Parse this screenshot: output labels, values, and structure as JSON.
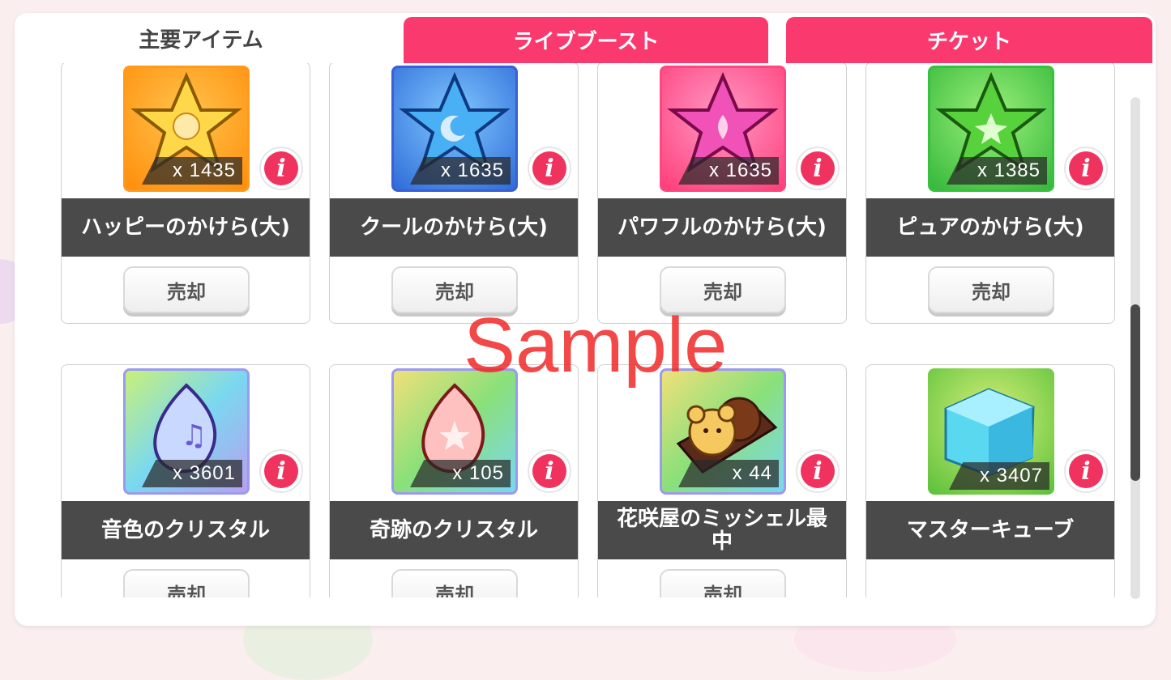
{
  "tabs": [
    {
      "label": "主要アイテム",
      "active": true
    },
    {
      "label": "ライブブースト",
      "active": false
    },
    {
      "label": "チケット",
      "active": false
    }
  ],
  "items": [
    {
      "name": "ハッピーのかけら(大)",
      "qty": "x 1435",
      "icon": "happy-star-icon",
      "sell": "売却"
    },
    {
      "name": "クールのかけら(大)",
      "qty": "x 1635",
      "icon": "cool-star-icon",
      "sell": "売却"
    },
    {
      "name": "パワフルのかけら(大)",
      "qty": "x 1635",
      "icon": "powerful-star-icon",
      "sell": "売却"
    },
    {
      "name": "ピュアのかけら(大)",
      "qty": "x 1385",
      "icon": "pure-star-icon",
      "sell": "売却"
    },
    {
      "name": "音色のクリスタル",
      "qty": "x 3601",
      "icon": "tone-crystal-icon",
      "sell": "売却"
    },
    {
      "name": "奇跡のクリスタル",
      "qty": "x 105",
      "icon": "miracle-crystal-icon",
      "sell": "売却"
    },
    {
      "name": "花咲屋のミッシェル最中",
      "qty": "x 44",
      "icon": "michelle-monaka-icon",
      "sell": "売却"
    },
    {
      "name": "マスターキューブ",
      "qty": "x 3407",
      "icon": "master-cube-icon",
      "sell": ""
    }
  ],
  "info_label": "i",
  "watermark": "Sample",
  "colors": {
    "tab_inactive": "#fa3a6f",
    "info": "#f0325f",
    "name_bar": "#4a4a4a"
  }
}
